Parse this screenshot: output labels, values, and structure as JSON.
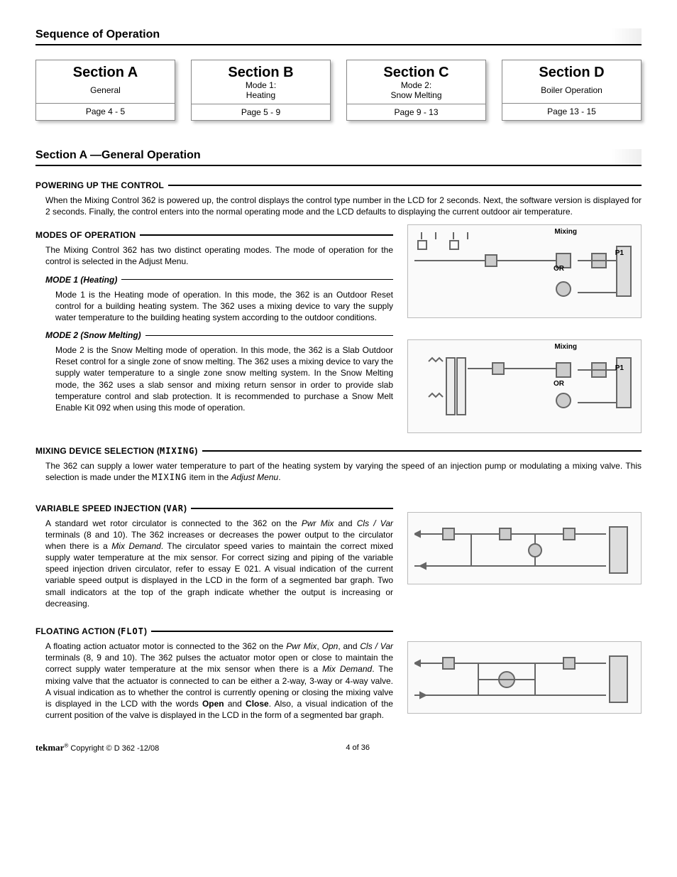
{
  "headers": {
    "seq": "Sequence of Operation",
    "sectionA": "Section A —General Operation"
  },
  "boxes": [
    {
      "title": "Section A",
      "sub": "General",
      "page": "Page 4 - 5"
    },
    {
      "title": "Section B",
      "sub": "Mode 1:\nHeating",
      "page": "Page 5 - 9"
    },
    {
      "title": "Section C",
      "sub": "Mode 2:\nSnow Melting",
      "page": "Page 9 - 13"
    },
    {
      "title": "Section D",
      "sub": "Boiler Operation",
      "page": "Page 13 - 15"
    }
  ],
  "powering": {
    "heading": "POWERING UP THE CONTROL",
    "text": "When the Mixing Control 362 is powered up, the control displays the control type number in the LCD for 2 seconds. Next, the software version is displayed for 2 seconds. Finally, the control enters into the normal operating mode and the LCD defaults to displaying the current outdoor air temperature."
  },
  "modes": {
    "heading": "MODES OF OPERATION",
    "intro": "The Mixing Control 362 has two distinct operating modes. The mode of operation for the control is selected in the Adjust Menu.",
    "mode1_h": "MODE 1 (Heating)",
    "mode1_t": "Mode 1 is the Heating mode of operation. In this mode, the 362 is an Outdoor Reset control for a building heating system. The 362 uses a mixing device to vary the supply water temperature to the building heating system according to the outdoor conditions.",
    "mode2_h": "MODE 2 (Snow Melting)",
    "mode2_t": "Mode 2 is the Snow Melting mode of operation. In this mode, the 362 is a Slab Outdoor Reset control for a single zone of snow melting. The 362 uses a mixing device to vary the supply water temperature to a single zone snow melting system. In the Snow Melting mode, the 362 uses a slab sensor and mixing return sensor in order to provide slab temperature control and slab protection. It is recommended to purchase a Snow Melt Enable Kit 092 when using this mode of operation."
  },
  "mixing_sel": {
    "heading_pre": "MIXING DEVICE SELECTION (",
    "heading_lcd": "MIXING",
    "heading_post": ")",
    "text_pre": "The 362 can supply a lower water temperature to part of the heating system by varying the speed of an injection pump or modulating a mixing valve. This selection is made under the ",
    "text_lcd": "MIXING",
    "text_mid": " item in the ",
    "text_em": "Adjust Menu",
    "text_post": "."
  },
  "vinj": {
    "heading_pre": "VARIABLE SPEED INJECTION (",
    "heading_lcd": "VAR",
    "heading_post": ")",
    "t_pre": "A standard wet rotor circulator is connected to the 362 on the ",
    "t_em1": "Pwr Mix",
    "t_mid1": " and ",
    "t_em2": "Cls / Var",
    "t_mid2": " terminals (8 and 10). The 362 increases or decreases the power output to the circulator when there is a ",
    "t_em3": "Mix Demand",
    "t_post": ". The circulator speed varies to maintain the correct mixed supply water temperature at the mix sensor. For correct sizing and piping of the variable speed injection driven circulator, refer to essay E 021. A visual indication of the current variable speed output is displayed in the LCD in the form of a segmented bar graph. Two small indicators at the top of the graph indicate whether the output is increasing or decreasing."
  },
  "flot": {
    "heading_pre": "FLOATING ACTION (",
    "heading_lcd": "FLOT",
    "heading_post": ")",
    "t_pre": "A floating action actuator motor is connected to the 362 on the ",
    "t_em1": "Pwr Mix",
    "t_c1": ", ",
    "t_em2": "Opn",
    "t_c2": ", and ",
    "t_em3": "Cls / Var",
    "t_mid": " terminals (8, 9 and 10). The 362 pulses the actuator motor open or close to maintain the correct supply water temperature at the mix sensor when there is a ",
    "t_em4": "Mix Demand",
    "t_mid2": ". The mixing valve that the actuator is connected to can be either a 2-way, 3-way or 4-way valve. A visual indication as to whether the control is currently opening or closing the mixing valve is displayed in the LCD with the words ",
    "t_b1": "Open",
    "t_and": " and ",
    "t_b2": "Close",
    "t_post": ". Also, a visual indication of the current position of the valve is displayed in the LCD in the form of a segmented bar graph."
  },
  "fig_labels": {
    "mixing": "Mixing",
    "or": "OR",
    "p1": "P1"
  },
  "footer": {
    "logo": "tekmar",
    "copyright": " Copyright © D 362 -12/08",
    "page": "4 of 36"
  }
}
